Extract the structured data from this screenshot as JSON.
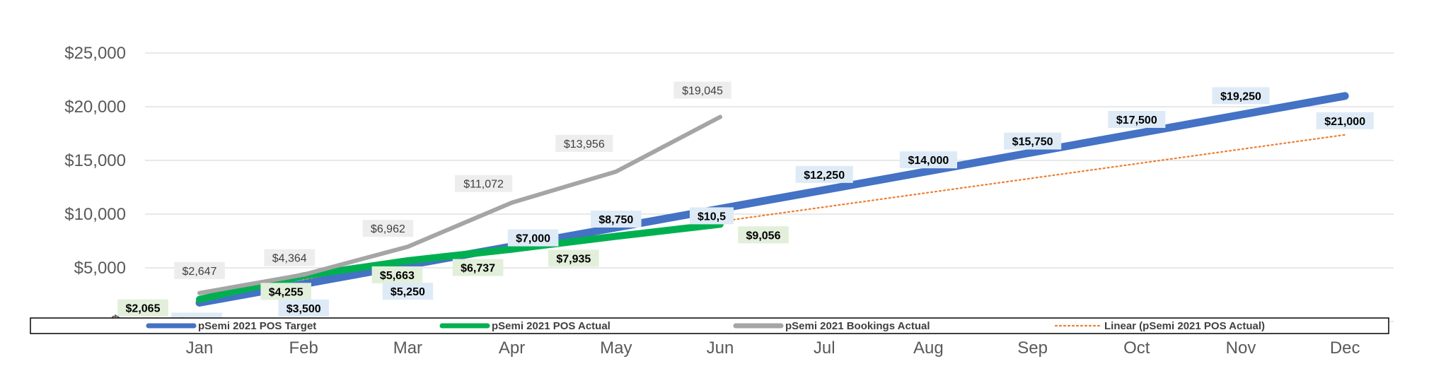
{
  "chart_data": {
    "type": "line",
    "categories": [
      "Jan",
      "Feb",
      "Mar",
      "Apr",
      "May",
      "Jun",
      "Jul",
      "Aug",
      "Sep",
      "Oct",
      "Nov",
      "Dec"
    ],
    "ylim": [
      0,
      25000
    ],
    "y_ticks": [
      0,
      5000,
      10000,
      15000,
      20000,
      25000
    ],
    "y_tick_labels": [
      "$-",
      "$5,000",
      "$10,000",
      "$15,000",
      "$20,000",
      "$25,000"
    ],
    "grid": true,
    "legend_position": "bottom",
    "series": [
      {
        "key": "target",
        "name": "pSemi 2021 POS Target",
        "color": "#4472C4",
        "values": [
          1750,
          3500,
          5250,
          7000,
          8750,
          10500,
          12250,
          14000,
          15750,
          17500,
          19250,
          21000
        ],
        "labels": [
          "$1,750",
          "$3,500",
          "$5,250",
          "$7,000",
          "$8,750",
          "$10,5",
          "$12,250",
          "$14,000",
          "$15,750",
          "$17,500",
          "$19,250",
          "$21,000"
        ],
        "label_bg": "#DEEBF7"
      },
      {
        "key": "actual",
        "name": "pSemi 2021 POS Actual",
        "color": "#00B050",
        "values": [
          2065,
          4255,
          5663,
          6737,
          7935,
          9056
        ],
        "labels": [
          "$2,065",
          "$4,255",
          "$5,663",
          "$6,737",
          "$7,935",
          "$9,056"
        ],
        "label_bg": "#E2EFDA"
      },
      {
        "key": "bookings",
        "name": "pSemi 2021 Bookings Actual",
        "color": "#A5A5A5",
        "values": [
          2647,
          4364,
          6962,
          11072,
          13956,
          19045
        ],
        "labels": [
          "$2,647",
          "$4,364",
          "$6,962",
          "$11,072",
          "$13,956",
          "$19,045"
        ],
        "label_bg": "#EDEDED"
      }
    ],
    "trendline": {
      "name": "Linear (pSemi 2021 POS Actual)",
      "color": "#ED7D31",
      "of_series": "actual",
      "style": "dotted"
    }
  }
}
